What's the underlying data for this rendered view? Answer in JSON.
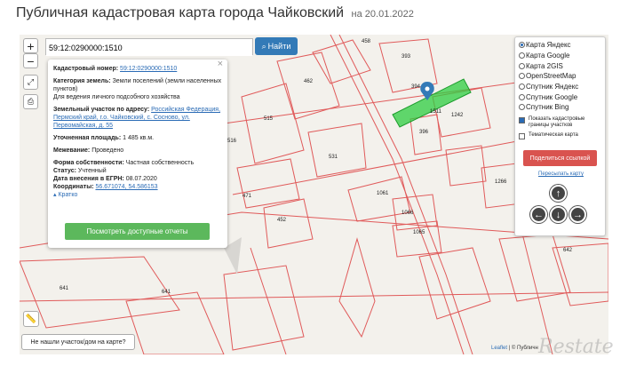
{
  "header": {
    "title": "Публичная кадастровая карта города Чайковский",
    "date": "на 20.01.2022"
  },
  "search": {
    "value": "59:12:0290000:1510",
    "button_label": "Найти"
  },
  "zoom": {
    "in": "+",
    "out": "−"
  },
  "popup": {
    "cad_number_label": "Кадастровый номер:",
    "cad_number": "59:12:0290000:1510",
    "land_category_label": "Категория земель:",
    "land_category": "Земли поселений (земли населенных пунктов)",
    "usage": "Для ведения личного подсобного хозяйства",
    "address_label": "Земельный участок по адресу:",
    "address": "Российская Федерация, Пермский край, г.о. Чайковский, с. Сосново, ул. Первомайская, д. 55",
    "area_label": "Уточненная площадь:",
    "area": "1 485 кв.м.",
    "survey_label": "Межевание:",
    "survey": "Проведено",
    "ownership_label": "Форма собственности:",
    "ownership": "Частная собственность",
    "status_label": "Статус:",
    "status": "Учтенный",
    "egrn_label": "Дата внесения в ЕГРН:",
    "egrn_date": "08.07.2020",
    "coords_label": "Координаты:",
    "coords": "56.671074, 54.586153",
    "collapse_label": "Кратко",
    "show_button": "Посмотреть доступные отчеты"
  },
  "layers": {
    "options": [
      {
        "label": "Карта Яндекс",
        "selected": true
      },
      {
        "label": "Карта Google",
        "selected": false
      },
      {
        "label": "Карта 2GIS",
        "selected": false
      },
      {
        "label": "OpenStreetMap",
        "selected": false
      },
      {
        "label": "Спутник Яндекс",
        "selected": false
      },
      {
        "label": "Спутник Google",
        "selected": false
      },
      {
        "label": "Спутник Bing",
        "selected": false
      }
    ],
    "show_boundaries": "Показать кадастровые границы участков",
    "thematic": "Тематическая карта",
    "share_button": "Поделиться ссылкой",
    "share_map": "Пересылать карту"
  },
  "not_found": "Не нашли участок/дом на карте?",
  "attribution": {
    "leaflet": "Leaflet",
    "rest": "| © Публичн"
  },
  "watermark": "Restate",
  "plot_labels": [
    "458",
    "393",
    "462",
    "394",
    "1511",
    "1242",
    "515",
    "396",
    "1266",
    "531",
    "516",
    "1061",
    "471",
    "452",
    "1066",
    "1065",
    "642",
    "641",
    "641"
  ],
  "colors": {
    "accent": "#337ab7",
    "green": "#5cb85c",
    "red": "#d9534f",
    "plot": "#e05a5a",
    "selected": "#2ecc40"
  }
}
